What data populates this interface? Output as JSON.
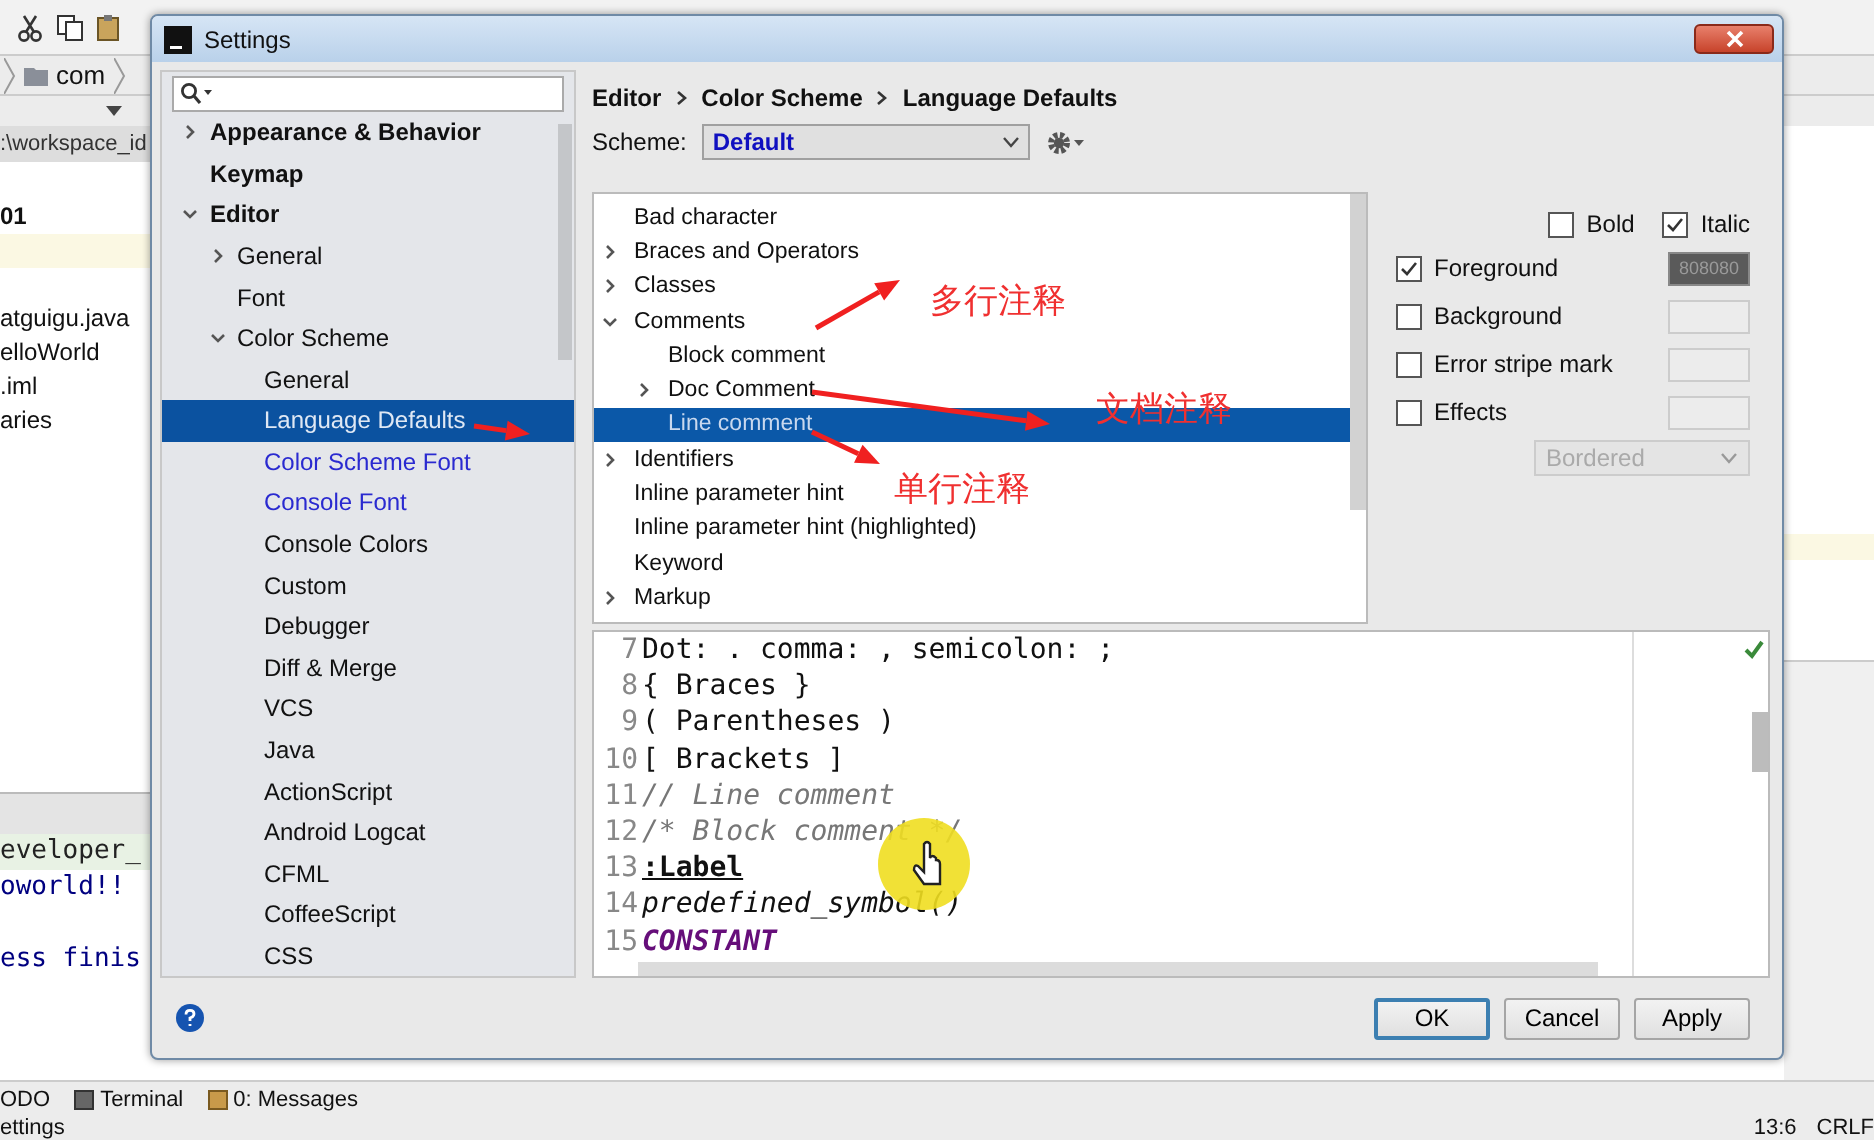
{
  "ide": {
    "breadcrumb": [
      "com"
    ],
    "path": ":\\workspace_id",
    "project_items": [
      {
        "label": "01",
        "bold": true
      },
      {
        "label": "atguigu.java",
        "bold": false
      },
      {
        "label": "elloWorld",
        "bold": false
      },
      {
        "label": ".iml",
        "bold": false
      },
      {
        "label": "aries",
        "bold": false
      }
    ],
    "console_lines": [
      "eveloper_",
      "oworld!!",
      "ess finis"
    ],
    "tool_tabs": [
      "ODO",
      "Terminal",
      "0: Messages"
    ],
    "status_bar": {
      "message": "ettings",
      "position": "13:6",
      "line_separator": "CRLF"
    }
  },
  "dialog": {
    "title": "Settings",
    "sidebar": {
      "items": [
        {
          "label": "Appearance & Behavior",
          "kind": "folder",
          "expanded": false,
          "selected": false,
          "modified": false
        },
        {
          "label": "Keymap",
          "kind": "page",
          "selected": false,
          "modified": false
        },
        {
          "label": "Editor",
          "kind": "folder",
          "expanded": true,
          "selected": false,
          "modified": false,
          "children": [
            {
              "label": "General",
              "kind": "folder",
              "expanded": false,
              "selected": false,
              "modified": false
            },
            {
              "label": "Font",
              "kind": "page",
              "selected": false,
              "modified": false
            },
            {
              "label": "Color Scheme",
              "kind": "folder",
              "expanded": true,
              "selected": false,
              "modified": false,
              "children": [
                {
                  "label": "General",
                  "kind": "page",
                  "selected": false,
                  "modified": false
                },
                {
                  "label": "Language Defaults",
                  "kind": "page",
                  "selected": true,
                  "modified": false
                },
                {
                  "label": "Color Scheme Font",
                  "kind": "page",
                  "selected": false,
                  "modified": true
                },
                {
                  "label": "Console Font",
                  "kind": "page",
                  "selected": false,
                  "modified": true
                },
                {
                  "label": "Console Colors",
                  "kind": "page",
                  "selected": false,
                  "modified": false
                },
                {
                  "label": "Custom",
                  "kind": "page",
                  "selected": false,
                  "modified": false
                },
                {
                  "label": "Debugger",
                  "kind": "page",
                  "selected": false,
                  "modified": false
                },
                {
                  "label": "Diff & Merge",
                  "kind": "page",
                  "selected": false,
                  "modified": false
                },
                {
                  "label": "VCS",
                  "kind": "page",
                  "selected": false,
                  "modified": false
                },
                {
                  "label": "Java",
                  "kind": "page",
                  "selected": false,
                  "modified": false
                },
                {
                  "label": "ActionScript",
                  "kind": "page",
                  "selected": false,
                  "modified": false
                },
                {
                  "label": "Android Logcat",
                  "kind": "page",
                  "selected": false,
                  "modified": false
                },
                {
                  "label": "CFML",
                  "kind": "page",
                  "selected": false,
                  "modified": false
                },
                {
                  "label": "CoffeeScript",
                  "kind": "page",
                  "selected": false,
                  "modified": false
                },
                {
                  "label": "CSS",
                  "kind": "page",
                  "selected": false,
                  "modified": false
                }
              ]
            }
          ]
        }
      ]
    },
    "breadcrumb": [
      "Editor",
      "Color Scheme",
      "Language Defaults"
    ],
    "scheme": {
      "label": "Scheme:",
      "value": "Default"
    },
    "tree": [
      {
        "label": "Bad character",
        "kind": "page",
        "selected": false
      },
      {
        "label": "Braces and Operators",
        "kind": "folder",
        "expanded": false,
        "selected": false
      },
      {
        "label": "Classes",
        "kind": "folder",
        "expanded": false,
        "selected": false
      },
      {
        "label": "Comments",
        "kind": "folder",
        "expanded": true,
        "selected": false,
        "children": [
          {
            "label": "Block comment",
            "kind": "page",
            "selected": false
          },
          {
            "label": "Doc Comment",
            "kind": "folder",
            "expanded": false,
            "selected": false
          },
          {
            "label": "Line comment",
            "kind": "page",
            "selected": true
          }
        ]
      },
      {
        "label": "Identifiers",
        "kind": "folder",
        "expanded": false,
        "selected": false
      },
      {
        "label": "Inline parameter hint",
        "kind": "page",
        "selected": false
      },
      {
        "label": "Inline parameter hint (highlighted)",
        "kind": "page",
        "selected": false
      },
      {
        "label": "Keyword",
        "kind": "page",
        "selected": false
      },
      {
        "label": "Markup",
        "kind": "folder",
        "expanded": false,
        "selected": false
      }
    ],
    "font_styles": [
      {
        "label": "Bold",
        "checked": false
      },
      {
        "label": "Italic",
        "checked": true
      }
    ],
    "attributes": [
      {
        "label": "Foreground",
        "checked": true,
        "value": "808080"
      },
      {
        "label": "Background",
        "checked": false
      },
      {
        "label": "Error stripe mark",
        "checked": false
      },
      {
        "label": "Effects",
        "checked": false
      }
    ],
    "effect_type": {
      "value": "Bordered",
      "disabled": true
    },
    "preview": [
      {
        "number": "7",
        "text": "Dot: . comma: , semicolon: ;",
        "kind": "plain"
      },
      {
        "number": "8",
        "text": "{ Braces }",
        "kind": "plain"
      },
      {
        "number": "9",
        "text": "( Parentheses )",
        "kind": "plain"
      },
      {
        "number": "10",
        "text": "[ Brackets ]",
        "kind": "plain"
      },
      {
        "number": "11",
        "text": "// Line comment",
        "kind": "comment"
      },
      {
        "number": "12",
        "text": "/* Block comment */",
        "kind": "comment"
      },
      {
        "number": "13",
        "text": ":Label",
        "kind": "label"
      },
      {
        "number": "14",
        "text": "predefined_symbol()",
        "kind": "symbol"
      },
      {
        "number": "15",
        "text": "CONSTANT",
        "kind": "constant"
      }
    ],
    "buttons": [
      {
        "label": "OK",
        "default": true
      },
      {
        "label": "Cancel",
        "default": false
      },
      {
        "label": "Apply",
        "default": false
      }
    ]
  },
  "annotations": [
    {
      "text": "多行注释"
    },
    {
      "text": "文档注释"
    },
    {
      "text": "单行注释"
    }
  ]
}
